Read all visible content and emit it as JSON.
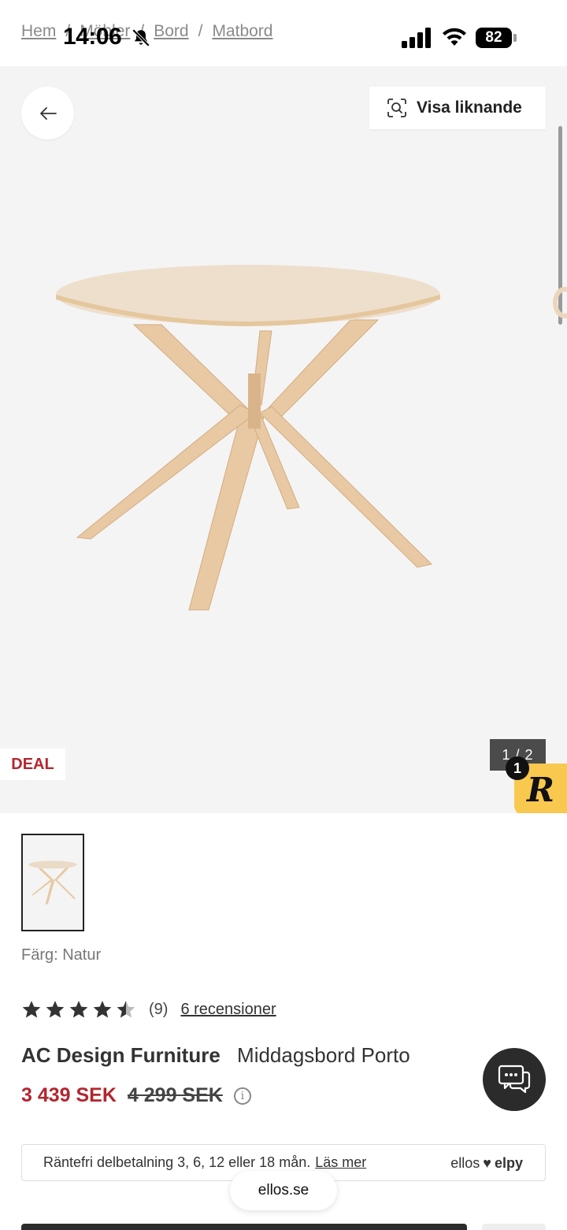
{
  "status_bar": {
    "time": "14:06",
    "battery": "82"
  },
  "breadcrumb": [
    "Hem",
    "Möbler",
    "Bord",
    "Matbord"
  ],
  "gallery": {
    "similar_label": "Visa liknande",
    "deal_label": "DEAL",
    "counter": "1 / 2",
    "rewards_count": "1",
    "rewards_letter": "R"
  },
  "product": {
    "color_label": "Färg: Natur",
    "rating_value": 4.5,
    "rating_count": "(9)",
    "reviews_link": "6 recensioner",
    "brand": "AC Design Furniture",
    "name": "Middagsbord Porto",
    "price": "3 439 SEK",
    "old_price": "4 299 SEK"
  },
  "installment": {
    "text": "Räntefri delbetalning 3, 6, 12 eller 18 mån.",
    "link": "Läs mer",
    "brand_left": "ellos",
    "brand_right": "elpy"
  },
  "browser": {
    "url": "ellos.se"
  },
  "colors": {
    "sale_red": "#b3262e",
    "badge_yellow": "#f9c84e",
    "dark": "#2b2b2b"
  }
}
